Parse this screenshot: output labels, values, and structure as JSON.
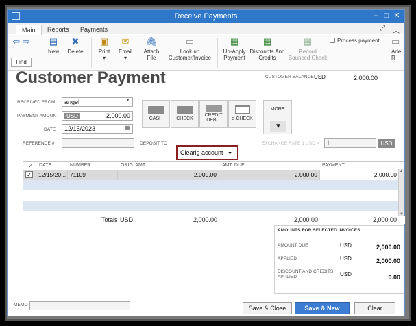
{
  "window": {
    "title": "Receive Payments"
  },
  "tabs": [
    {
      "label": "Main"
    },
    {
      "label": "Reports"
    },
    {
      "label": "Payments"
    }
  ],
  "ribbon": {
    "find": "Find",
    "new": "New",
    "delete": "Delete",
    "print": "Print",
    "email": "Email",
    "attach_line1": "Attach",
    "attach_line2": "File",
    "lookup_line1": "Look up",
    "lookup_line2": "Customer/Invoice",
    "unapply_line1": "Un-Apply",
    "unapply_line2": "Payment",
    "discounts_line1": "Discounts And",
    "discounts_line2": "Credits",
    "record_line1": "Record",
    "record_line2": "Bounced Check",
    "process_payment": "Process payment",
    "partial_line1": "Ade",
    "partial_line2": "R"
  },
  "header": {
    "title": "Customer Payment",
    "customer_balance_label": "CUSTOMER BALANCE",
    "customer_balance_currency": "USD",
    "customer_balance_value": "2,000.00"
  },
  "form": {
    "received_from_label": "RECEIVED FROM",
    "received_from_value": "angel",
    "payment_amount_label": "PAYMENT AMOUNT",
    "payment_currency": "USD",
    "payment_amount_value": "2,000.00",
    "date_label": "DATE",
    "date_value": "12/15/2023",
    "reference_label": "REFERENCE #",
    "reference_value": "",
    "deposit_to_label": "DEPOSIT TO",
    "deposit_to_value": "Clearig account",
    "exchange_rate_label": "EXCHANGE RATE 1 USD =",
    "exchange_rate_value": "1",
    "exchange_currency": "USD"
  },
  "payment_methods": [
    {
      "label": "CASH"
    },
    {
      "label": "CHECK"
    },
    {
      "label_line1": "CREDIT",
      "label_line2": "DEBIT"
    },
    {
      "label": "e-CHECK"
    }
  ],
  "more_label": "MORE",
  "table": {
    "columns": {
      "check": "✓",
      "date": "DATE",
      "number": "NUMBER",
      "orig_amt": "ORIG. AMT.",
      "amt_due": "AMT. DUE",
      "payment": "PAYMENT"
    },
    "rows": [
      {
        "check": "✓",
        "date": "12/15/20...",
        "number": "71109",
        "orig_amt": "2,000.00",
        "amt_due": "2,000.00",
        "payment": "2,000.00"
      }
    ],
    "totals": {
      "label": "Totals",
      "currency": "USD",
      "orig_amt": "2,000.00",
      "amt_due": "2,000.00",
      "payment": "2,000.00"
    }
  },
  "amounts_panel": {
    "title": "AMOUNTS FOR SELECTED INVOICES",
    "amount_due_label": "AMOUNT DUE",
    "amount_due_currency": "USD",
    "amount_due_value": "2,000.00",
    "applied_label": "APPLIED",
    "applied_currency": "USD",
    "applied_value": "2,000.00",
    "discount_label_line1": "DISCOUNT AND CREDITS",
    "discount_label_line2": "APPLIED",
    "discount_currency": "USD",
    "discount_value": "0.00"
  },
  "memo_label": "MEMO",
  "memo_value": "",
  "buttons": {
    "save_close": "Save & Close",
    "save_new": "Save & New",
    "clear": "Clear"
  }
}
